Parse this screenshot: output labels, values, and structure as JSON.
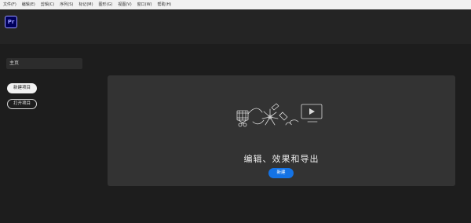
{
  "menubar": {
    "items": [
      "文件(F)",
      "编辑(E)",
      "剪辑(C)",
      "序列(S)",
      "标记(M)",
      "图形(G)",
      "视图(V)",
      "窗口(W)",
      "帮助(H)"
    ]
  },
  "app": {
    "logo_text": "Pr"
  },
  "sidebar": {
    "home_label": "主页",
    "new_project_label": "新建项目",
    "open_project_label": "打开项目"
  },
  "hero": {
    "title": "编辑、效果和导出",
    "button_label": "新建"
  },
  "colors": {
    "accent": "#1473e6",
    "background": "#1d1d1d",
    "card": "#333333",
    "logo_bg": "#00005b",
    "logo_fg": "#9999ff"
  }
}
